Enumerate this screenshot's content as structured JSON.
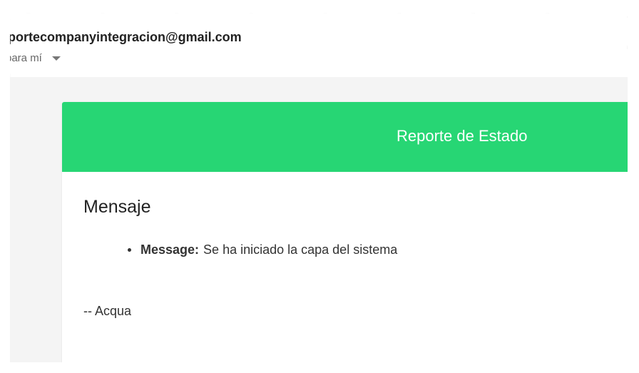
{
  "email": {
    "sender": "oportecompanyintegracion@gmail.com",
    "recipient_label": "para mí"
  },
  "card": {
    "header_title": "Reporte de Estado",
    "section_title": "Mensaje",
    "items": [
      {
        "key": "Message:",
        "value": "Se ha iniciado la capa del sistema"
      }
    ],
    "signature": "-- Acqua"
  },
  "colors": {
    "header_green": "#27d674",
    "mail_background": "#f4f4f4"
  },
  "icons": {
    "recipient_dropdown": "chevron-down-icon"
  }
}
